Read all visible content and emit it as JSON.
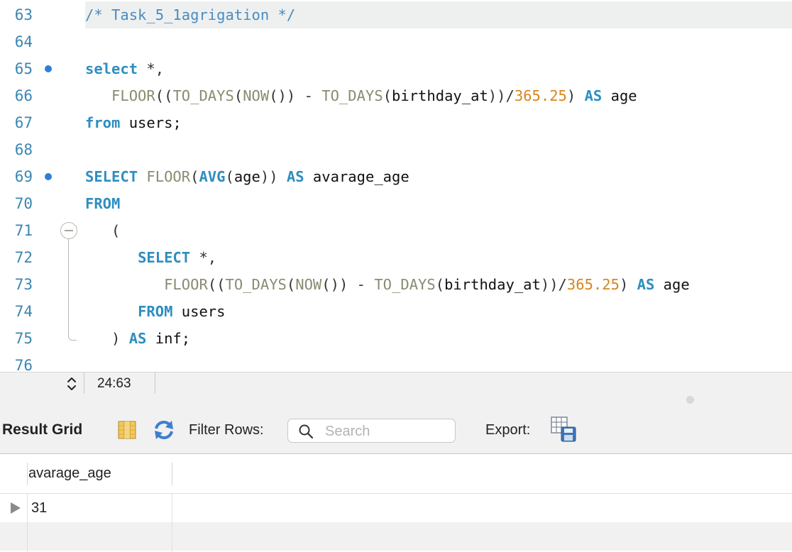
{
  "editor": {
    "lines": [
      {
        "num": "63",
        "breakpoint": false,
        "highlight": true,
        "tokens": [
          {
            "t": "cm",
            "v": "/* Task_5_1agrigation */"
          }
        ]
      },
      {
        "num": "64",
        "breakpoint": false,
        "tokens": []
      },
      {
        "num": "65",
        "breakpoint": true,
        "tokens": [
          {
            "t": "kw",
            "v": "select"
          },
          {
            "t": "op",
            "v": " *,"
          }
        ]
      },
      {
        "num": "66",
        "breakpoint": false,
        "tokens": [
          {
            "t": "id",
            "v": "   "
          },
          {
            "t": "fn",
            "v": "FLOOR"
          },
          {
            "t": "op",
            "v": "(("
          },
          {
            "t": "fn",
            "v": "TO_DAYS"
          },
          {
            "t": "op",
            "v": "("
          },
          {
            "t": "fn",
            "v": "NOW"
          },
          {
            "t": "op",
            "v": "()) - "
          },
          {
            "t": "fn",
            "v": "TO_DAYS"
          },
          {
            "t": "op",
            "v": "("
          },
          {
            "t": "id",
            "v": "birthday_at"
          },
          {
            "t": "op",
            "v": "))/"
          },
          {
            "t": "num",
            "v": "365.25"
          },
          {
            "t": "op",
            "v": ") "
          },
          {
            "t": "kw",
            "v": "AS"
          },
          {
            "t": "id",
            "v": " age"
          }
        ]
      },
      {
        "num": "67",
        "breakpoint": false,
        "tokens": [
          {
            "t": "kw",
            "v": "from"
          },
          {
            "t": "id",
            "v": " users;"
          }
        ]
      },
      {
        "num": "68",
        "breakpoint": false,
        "tokens": []
      },
      {
        "num": "69",
        "breakpoint": true,
        "tokens": [
          {
            "t": "kw",
            "v": "SELECT"
          },
          {
            "t": "id",
            "v": " "
          },
          {
            "t": "fn",
            "v": "FLOOR"
          },
          {
            "t": "op",
            "v": "("
          },
          {
            "t": "kw",
            "v": "AVG"
          },
          {
            "t": "op",
            "v": "("
          },
          {
            "t": "id",
            "v": "age"
          },
          {
            "t": "op",
            "v": ")) "
          },
          {
            "t": "kw",
            "v": "AS"
          },
          {
            "t": "id",
            "v": " avarage_age"
          }
        ]
      },
      {
        "num": "70",
        "breakpoint": false,
        "tokens": [
          {
            "t": "kw",
            "v": "FROM"
          }
        ]
      },
      {
        "num": "71",
        "breakpoint": false,
        "tokens": [
          {
            "t": "op",
            "v": "   ("
          }
        ]
      },
      {
        "num": "72",
        "breakpoint": false,
        "tokens": [
          {
            "t": "id",
            "v": "      "
          },
          {
            "t": "kw",
            "v": "SELECT"
          },
          {
            "t": "op",
            "v": " *,"
          }
        ]
      },
      {
        "num": "73",
        "breakpoint": false,
        "tokens": [
          {
            "t": "id",
            "v": "         "
          },
          {
            "t": "fn",
            "v": "FLOOR"
          },
          {
            "t": "op",
            "v": "(("
          },
          {
            "t": "fn",
            "v": "TO_DAYS"
          },
          {
            "t": "op",
            "v": "("
          },
          {
            "t": "fn",
            "v": "NOW"
          },
          {
            "t": "op",
            "v": "()) - "
          },
          {
            "t": "fn",
            "v": "TO_DAYS"
          },
          {
            "t": "op",
            "v": "("
          },
          {
            "t": "id",
            "v": "birthday_at"
          },
          {
            "t": "op",
            "v": "))/"
          },
          {
            "t": "num",
            "v": "365.25"
          },
          {
            "t": "op",
            "v": ") "
          },
          {
            "t": "kw",
            "v": "AS"
          },
          {
            "t": "id",
            "v": " age"
          }
        ]
      },
      {
        "num": "74",
        "breakpoint": false,
        "tokens": [
          {
            "t": "id",
            "v": "      "
          },
          {
            "t": "kw",
            "v": "FROM"
          },
          {
            "t": "id",
            "v": " users"
          }
        ]
      },
      {
        "num": "75",
        "breakpoint": false,
        "tokens": [
          {
            "t": "op",
            "v": "   ) "
          },
          {
            "t": "kw",
            "v": "AS"
          },
          {
            "t": "id",
            "v": " inf;"
          }
        ]
      },
      {
        "num": "76",
        "breakpoint": false,
        "tokens": []
      }
    ]
  },
  "statusbar": {
    "cursor_position": "24:63"
  },
  "toolbar": {
    "result_grid_label": "Result Grid",
    "filter_rows_label": "Filter Rows:",
    "search_placeholder": "Search",
    "export_label": "Export:"
  },
  "grid": {
    "columns": [
      "avarage_age"
    ],
    "rows": [
      [
        "31"
      ]
    ]
  },
  "colors": {
    "keyword": "#2e8ec0",
    "function": "#8b8a72",
    "number": "#d6861e",
    "comment": "#4a8cc0",
    "line_number": "#3a86b2",
    "breakpoint": "#2d7fd6"
  }
}
